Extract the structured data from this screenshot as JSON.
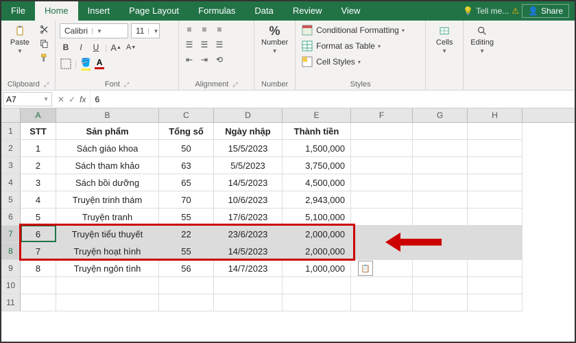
{
  "tabs": {
    "file": "File",
    "home": "Home",
    "insert": "Insert",
    "pageLayout": "Page Layout",
    "formulas": "Formulas",
    "data": "Data",
    "review": "Review",
    "view": "View"
  },
  "ribbonRight": {
    "tellMe": "Tell me...",
    "share": "Share"
  },
  "groups": {
    "clipboard": {
      "label": "Clipboard",
      "paste": "Paste"
    },
    "font": {
      "label": "Font",
      "fontName": "Calibri",
      "fontSize": "11"
    },
    "alignment": {
      "label": "Alignment"
    },
    "number": {
      "label": "Number",
      "btn": "Number",
      "fmt": "%"
    },
    "styles": {
      "label": "Styles",
      "cond": "Conditional Formatting",
      "table": "Format as Table",
      "cell": "Cell Styles"
    },
    "cells": {
      "label": "Cells"
    },
    "editing": {
      "label": "Editing"
    }
  },
  "nameBox": "A7",
  "formula": "6",
  "columns": [
    "A",
    "B",
    "C",
    "D",
    "E",
    "F",
    "G",
    "H"
  ],
  "headerRow": {
    "stt": "STT",
    "sp": "Sản phẩm",
    "ts": "Tổng số",
    "nn": "Ngày nhập",
    "tt": "Thành tiền"
  },
  "rows": [
    {
      "r": "1"
    },
    {
      "r": "2",
      "stt": "1",
      "sp": "Sách giáo khoa",
      "ts": "50",
      "nn": "15/5/2023",
      "tt": "1,500,000"
    },
    {
      "r": "3",
      "stt": "2",
      "sp": "Sách tham khảo",
      "ts": "63",
      "nn": "5/5/2023",
      "tt": "3,750,000"
    },
    {
      "r": "4",
      "stt": "3",
      "sp": "Sách bồi dưỡng",
      "ts": "65",
      "nn": "14/5/2023",
      "tt": "4,500,000"
    },
    {
      "r": "5",
      "stt": "4",
      "sp": "Truyện trinh thám",
      "ts": "70",
      "nn": "10/6/2023",
      "tt": "2,943,000"
    },
    {
      "r": "6",
      "stt": "5",
      "sp": "Truyện tranh",
      "ts": "55",
      "nn": "17/6/2023",
      "tt": "5,100,000"
    },
    {
      "r": "7",
      "stt": "6",
      "sp": "Truyện tiểu thuyết",
      "ts": "22",
      "nn": "23/6/2023",
      "tt": "2,000,000"
    },
    {
      "r": "8",
      "stt": "7",
      "sp": "Truyện hoạt hình",
      "ts": "55",
      "nn": "14/5/2023",
      "tt": "2,000,000"
    },
    {
      "r": "9",
      "stt": "8",
      "sp": "Truyện ngôn tình",
      "ts": "56",
      "nn": "14/7/2023",
      "tt": "1,000,000"
    },
    {
      "r": "10"
    },
    {
      "r": "11"
    }
  ]
}
